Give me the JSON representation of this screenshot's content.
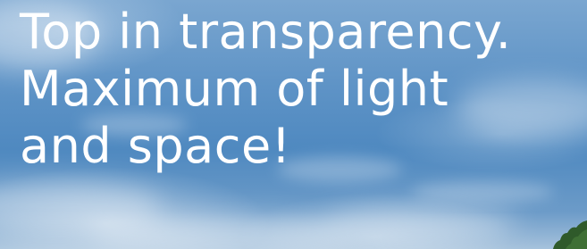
{
  "headline": {
    "lines": [
      "Top in transparency.",
      "Maximum of light",
      "and space!"
    ]
  },
  "colors": {
    "sky_top": "#7aa6d0",
    "sky_mid": "#4f89c0",
    "sky_bottom": "#a6c2dc",
    "text": "#ffffff",
    "foliage": "#2f5a2a"
  }
}
